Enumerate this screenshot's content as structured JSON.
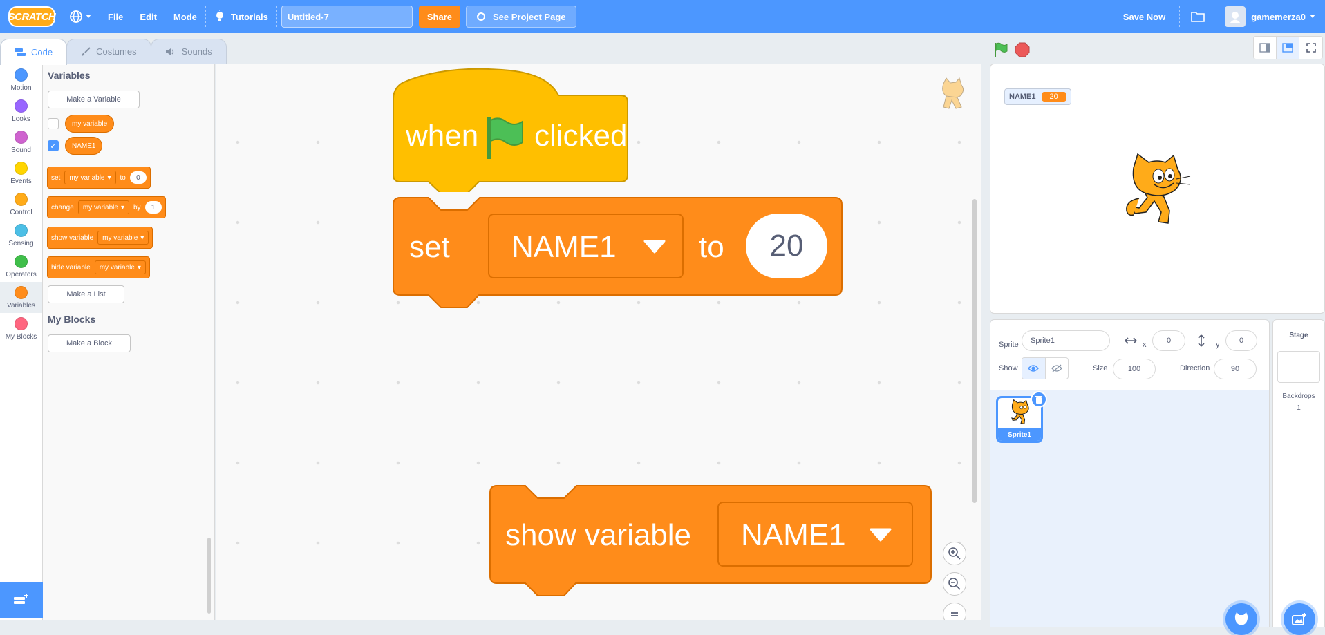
{
  "menubar": {
    "logo": "SCRATCH",
    "file": "File",
    "edit": "Edit",
    "mode": "Mode",
    "tutorials": "Tutorials",
    "project_title": "Untitled-7",
    "share": "Share",
    "see_project_page": "See Project Page",
    "save_now": "Save Now",
    "username": "gamemerza0"
  },
  "tabs": {
    "code": "Code",
    "costumes": "Costumes",
    "sounds": "Sounds"
  },
  "categories": [
    {
      "label": "Motion",
      "color": "#4c97ff"
    },
    {
      "label": "Looks",
      "color": "#9966ff"
    },
    {
      "label": "Sound",
      "color": "#cf63cf"
    },
    {
      "label": "Events",
      "color": "#ffd500"
    },
    {
      "label": "Control",
      "color": "#ffab19"
    },
    {
      "label": "Sensing",
      "color": "#4cbfe6"
    },
    {
      "label": "Operators",
      "color": "#40bf4a"
    },
    {
      "label": "Variables",
      "color": "#ff8c1a"
    },
    {
      "label": "My Blocks",
      "color": "#ff6680"
    }
  ],
  "palette": {
    "variables_heading": "Variables",
    "make_variable": "Make a Variable",
    "var1": "my variable",
    "var2": "NAME1",
    "set_block": {
      "word": "set",
      "var": "my variable",
      "to": "to",
      "value": "0"
    },
    "change_block": {
      "word": "change",
      "var": "my variable",
      "by": "by",
      "value": "1"
    },
    "show_block": {
      "word": "show variable",
      "var": "my variable"
    },
    "hide_block": {
      "word": "hide variable",
      "var": "my variable"
    },
    "make_list": "Make a List",
    "my_blocks_heading": "My Blocks",
    "make_block": "Make a Block"
  },
  "script": {
    "hat_when": "when",
    "hat_clicked": "clicked",
    "set_word": "set",
    "set_var": "NAME1",
    "set_to": "to",
    "set_value": "20",
    "show_word": "show variable",
    "show_var": "NAME1"
  },
  "stage": {
    "monitor_name": "NAME1",
    "monitor_value": "20"
  },
  "sprite_info": {
    "sprite_label": "Sprite",
    "sprite_name": "Sprite1",
    "x_label": "x",
    "x_value": "0",
    "y_label": "y",
    "y_value": "0",
    "show_label": "Show",
    "size_label": "Size",
    "size_value": "100",
    "direction_label": "Direction",
    "direction_value": "90"
  },
  "sprites": [
    {
      "name": "Sprite1"
    }
  ],
  "stage_panel": {
    "title": "Stage",
    "backdrops_label": "Backdrops",
    "backdrops_count": "1"
  }
}
